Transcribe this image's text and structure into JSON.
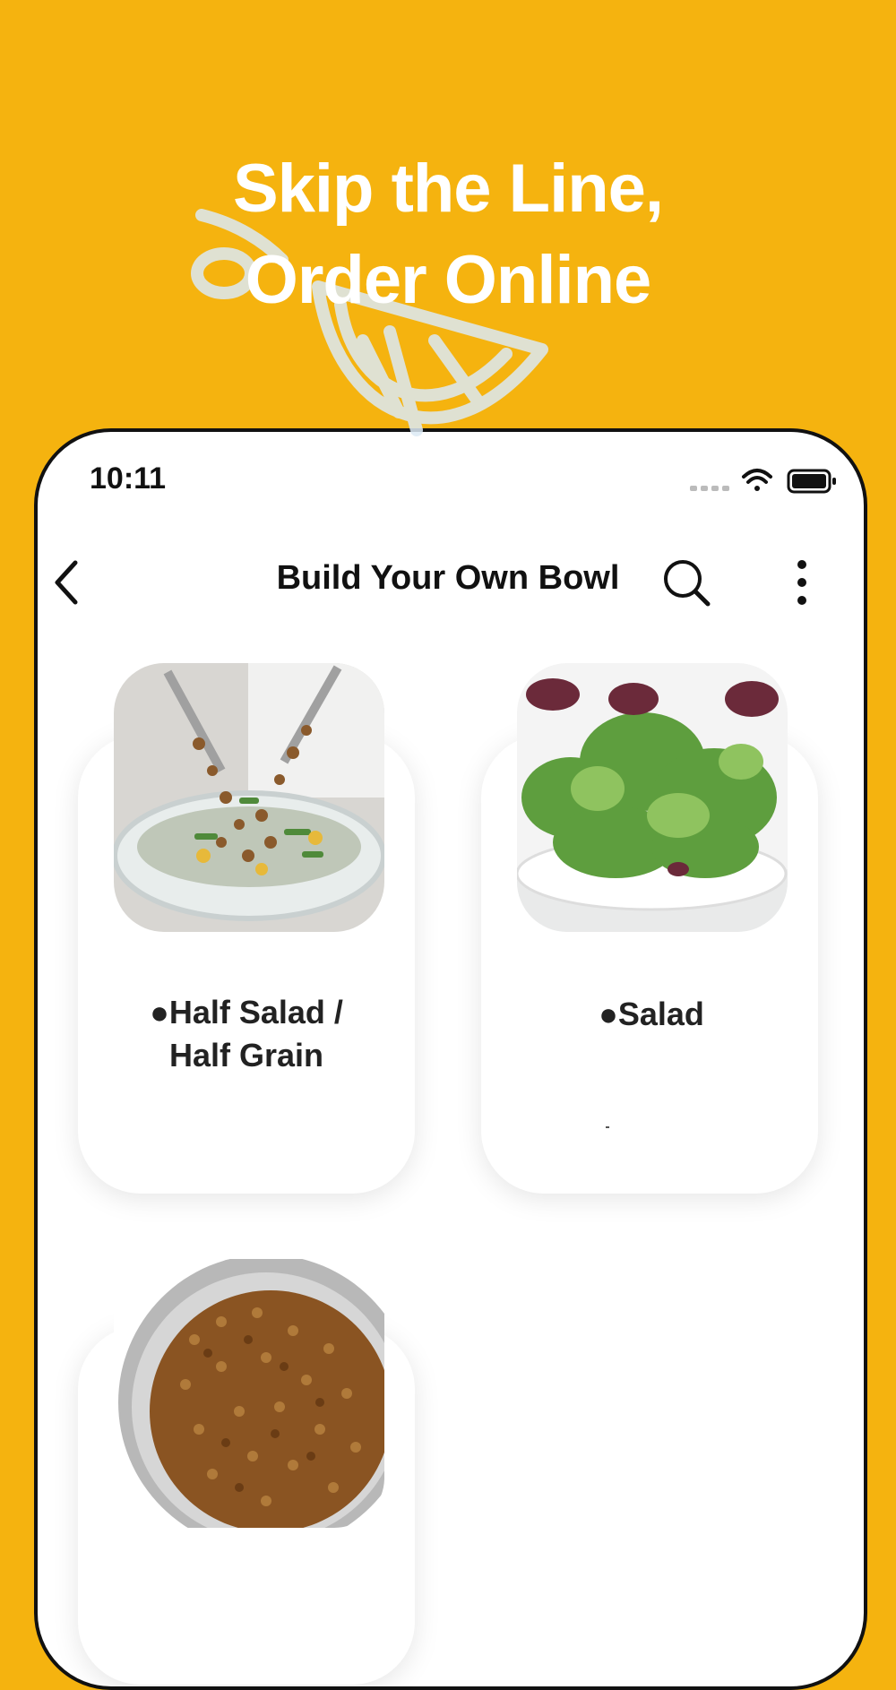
{
  "promo": {
    "line1": "Skip the Line,",
    "line2": "Order Online"
  },
  "status_bar": {
    "time": "10:11"
  },
  "nav": {
    "title": "Build Your Own Bowl"
  },
  "items": [
    {
      "label": "●Half Salad / Half Grain"
    },
    {
      "label": "●Salad"
    },
    {
      "label": ""
    }
  ],
  "colors": {
    "background": "#F5B30F",
    "headline": "#FFFFFF",
    "text": "#111111"
  },
  "icons": [
    "back-chevron-icon",
    "search-icon",
    "more-vertical-icon",
    "wifi-icon",
    "battery-icon",
    "signal-icon",
    "lemon-logo"
  ]
}
